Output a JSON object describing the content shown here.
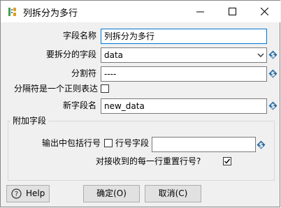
{
  "window": {
    "title": "列拆分为多行",
    "icon": "split-columns-icon"
  },
  "form": {
    "field_name_label": "字段名称",
    "field_name_value": "列拆分为多行",
    "split_field_label": "要拆分的字段",
    "split_field_value": "data",
    "separator_label": "分割符",
    "separator_value": "----",
    "regex_label": "分隔符是一个正则表达",
    "regex_checked": false,
    "new_field_label": "新字段名",
    "new_field_value": "new_data"
  },
  "extra": {
    "group_title": "附加字段",
    "include_rownum_label": "输出中包括行号",
    "include_rownum_checked": false,
    "rownum_field_label": "行号字段",
    "rownum_field_value": "",
    "reset_label": "对接收到的每一行重置行号?",
    "reset_checked": true
  },
  "buttons": {
    "help": "Help",
    "ok": "确定(O)",
    "cancel": "取消(C)"
  },
  "colors": {
    "variable_icon": "#2d6ca2",
    "focus_border": "#0078d7"
  }
}
